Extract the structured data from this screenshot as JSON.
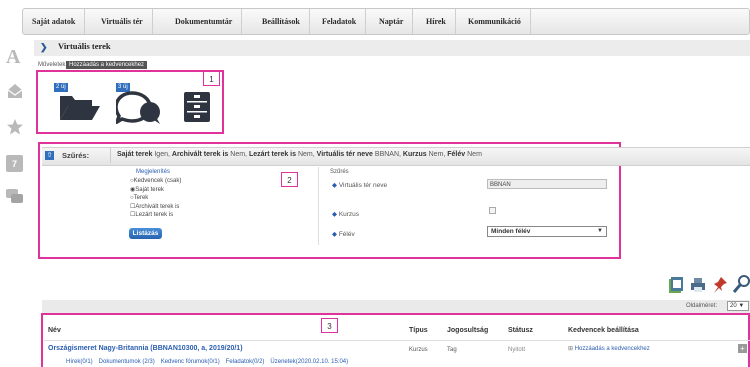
{
  "nav": [
    "Saját adatok",
    "Virtuális tér",
    "Dokumentumtár",
    "Beállítások",
    "Feladatok",
    "Naptár",
    "Hírek",
    "Kommunikáció"
  ],
  "sidebar_badge": "7",
  "page_title": "Virtuális terek",
  "actions_label": "Műveletek:",
  "tooltip": "Hozzáadás a kedvencekhez",
  "annotations": [
    "1",
    "2",
    "3"
  ],
  "tiles": {
    "folder_badge": "2 új",
    "forum_badge": "3 új"
  },
  "filter": {
    "label": "Szűrés:",
    "summary_parts": [
      {
        "b": "Saját terek",
        "v": " Igen, "
      },
      {
        "b": "Archivált terek is",
        "v": " Nem, "
      },
      {
        "b": "Lezárt terek is",
        "v": " Nem, "
      },
      {
        "b": "Virtuális tér neve",
        "v": " BBNAN, "
      },
      {
        "b": "Kurzus",
        "v": " Nem, "
      },
      {
        "b": "Félév",
        "v": " Nem"
      }
    ],
    "display_title": "Megjelenítés",
    "options": [
      "Kedvencek (csak)",
      "Saját terek",
      "Terek",
      "Archivált terek is",
      "Lezárt terek is"
    ],
    "list_button": "Listázás",
    "filter_title": "Szűrés",
    "name_label": "Virtuális tér neve",
    "name_value": "BBNAN",
    "course_label": "Kurzus",
    "semester_label": "Félév",
    "semester_value": "Minden félév"
  },
  "pager": {
    "label": "Oldalméret:",
    "value": "20"
  },
  "table": {
    "headers": {
      "name": "Név",
      "type": "Típus",
      "perm": "Jogosultság",
      "status": "Státusz",
      "fav": "Kedvencek beállítása"
    },
    "row": {
      "name": "Országismeret Nagy-Britannia (BBNAN10300, a, 2019/20/1)",
      "type": "Kurzus",
      "perm": "Tag",
      "status": "Nyitott",
      "fav": "Hozzáadás a kedvencekhez",
      "links": [
        "Hírek(0/1)",
        "Dokumentumok (2/3)",
        "Kedvenc fórumok(0/1)",
        "Feladatok(0/2)",
        "Üzenetek(2020.02.10. 15:04)"
      ]
    }
  }
}
